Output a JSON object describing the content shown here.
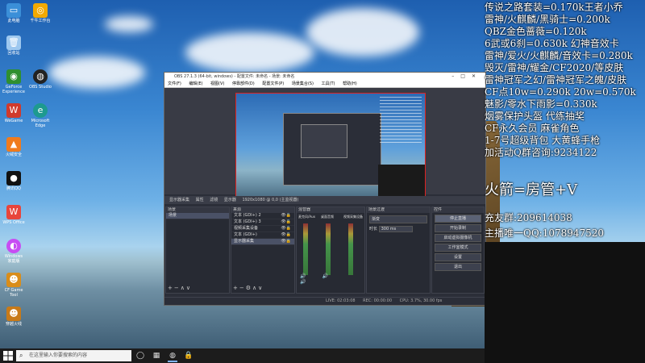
{
  "desktop": {
    "icons": [
      {
        "label": "此电脑",
        "icon": "computer-icon",
        "color": "#3b8fd8"
      },
      {
        "label": "千牛工作台",
        "icon": "qianniu-icon",
        "color": "#f2a900"
      },
      {
        "label": "回收站",
        "icon": "recycle-bin-icon",
        "color": "#9ec8ef"
      },
      {
        "label": "GeForce Experience",
        "icon": "nvidia-icon",
        "color": "#2f8f2f"
      },
      {
        "label": "OBS Studio",
        "icon": "obs-icon",
        "color": "#222222"
      },
      {
        "label": "WeGame",
        "icon": "wegame-icon",
        "color": "#d03a2c"
      },
      {
        "label": "Microsoft Edge",
        "icon": "edge-icon",
        "color": "#1d9a8f"
      },
      {
        "label": "火绒安全",
        "icon": "huorong-icon",
        "color": "#f07b1d"
      },
      {
        "label": "腾讯QQ",
        "icon": "qq-icon",
        "color": "#111111"
      },
      {
        "label": "WPS Office",
        "icon": "wps-icon",
        "color": "#e8453c"
      },
      {
        "label": "Windows 家庭版",
        "icon": "windows-color-icon",
        "color": "#c74df3"
      },
      {
        "label": "CF Game Tool",
        "icon": "cf-game-icon",
        "color": "#d98d1a"
      },
      {
        "label": "穿越火线",
        "icon": "crossfire-icon",
        "color": "#c87a18"
      }
    ]
  },
  "obs": {
    "title": "OBS 27.1.3 (64-bit, windows) - 配置文件: 未命名 - 场景: 未命名",
    "menu": [
      "文件(F)",
      "编辑(E)",
      "视图(V)",
      "停靠部件(D)",
      "配置文件(P)",
      "场景集合(S)",
      "工具(T)",
      "帮助(H)"
    ],
    "dock_header": [
      "显示器采集",
      "属性",
      "滤镜",
      "显示器",
      "1920x1080 @ 0,0 (主监视器)"
    ],
    "scenes": {
      "title": "场景",
      "items": [
        "场景"
      ]
    },
    "sources": {
      "title": "来源",
      "items": [
        "文本 (GDI+) 2",
        "文本 (GDI+) 3",
        "视频采集设备",
        "文本 (GDI+)",
        "显示器采集"
      ]
    },
    "mixer": {
      "title": "混音器",
      "channels": [
        "麦克风/Aux",
        "桌面音频",
        "视频采集设备"
      ]
    },
    "transitions": {
      "title": "场景过渡",
      "type": "渐变",
      "duration_label": "时长",
      "duration": "300 ms"
    },
    "controls": {
      "title": "控件",
      "buttons": [
        "停止直播",
        "开始录制",
        "启动虚拟摄像机",
        "工作室模式",
        "设置",
        "退出"
      ]
    },
    "status": {
      "live": "LIVE: 02:03:08",
      "rec": "REC: 00:00:00",
      "cpu": "CPU: 3.7%, 30.00 fps"
    }
  },
  "overlay": {
    "lines": [
      "传说之路套装=0.170k王者小乔",
      "雷神/火麒麟/黑骑士=0.200k",
      "QBZ金色蔷薇=0.120k",
      "6武或6刹=0.630k 幻神音效卡",
      "雷神/爱火/火麒麟/音效卡=0.280k",
      "毁灭/雷神/耀金/CF2020/等皮肤",
      "雷神冠军之幻/雷神冠军之魄/皮肤",
      "CF点10w=0.290k 20w=0.570k",
      "魅影/零水下雨影=0.330k",
      "烟雾保护头盔 代练抽奖",
      "CF永久会员 麻雀角色",
      "1-7号超级背包 大黄蜂手枪",
      "加活动Q群咨询:9234122"
    ],
    "big_line": "火箭=房管+V",
    "lower_lines": [
      "充友群:209614038",
      "主播唯一QQ:1078947520"
    ]
  },
  "taskbar": {
    "search_placeholder": "在这里输入你要搜索的内容",
    "icons": [
      "task-view-icon",
      "edge-taskbar-icon",
      "obs-taskbar-icon",
      "lock-taskbar-icon"
    ]
  }
}
